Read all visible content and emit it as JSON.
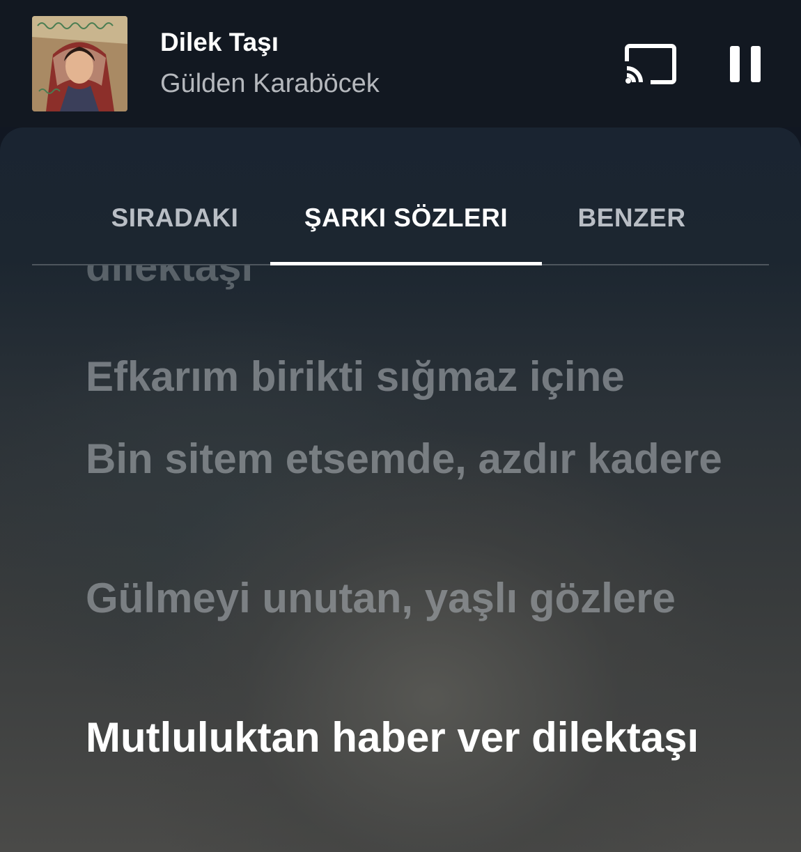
{
  "player": {
    "title": "Dilek Taşı",
    "artist": "Gülden Karaböcek",
    "cast_icon": "cast-icon",
    "pause_icon": "pause-icon"
  },
  "tabs": [
    {
      "label": "SIRADAKI",
      "selected": false
    },
    {
      "label": "ŞARKI SÖZLERI",
      "selected": true
    },
    {
      "label": "BENZER",
      "selected": false
    }
  ],
  "lyrics": [
    {
      "text": "dilektaşı",
      "state": "past"
    },
    {
      "text": "Efkarım birikti sığmaz içine",
      "state": "past"
    },
    {
      "text": "Bin sitem etsemde, azdır kadere",
      "state": "past"
    },
    {
      "text": "Gülmeyi unutan, yaşlı gözlere",
      "state": "past"
    },
    {
      "text": "Mutluluktan haber ver dilektaşı",
      "state": "current"
    }
  ],
  "colors": {
    "accent": "#ffffff",
    "inactive_tab": "#b9bec5",
    "header_bg": "#121821"
  }
}
